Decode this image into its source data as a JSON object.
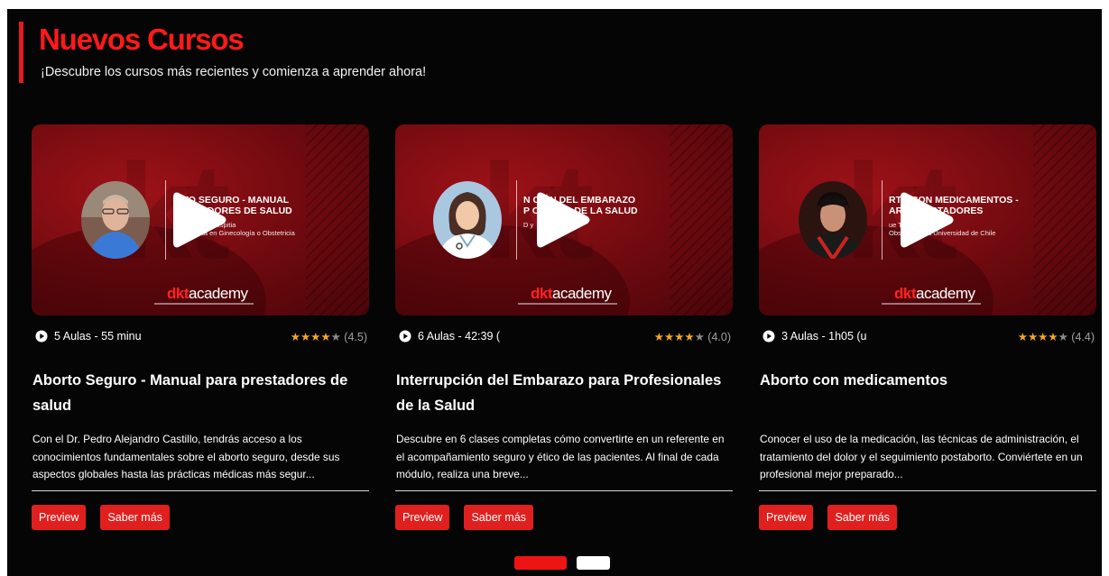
{
  "section": {
    "title": "Nuevos Cursos",
    "subtitle": "¡Descubre los cursos más recientes y comienza a aprender ahora!"
  },
  "colors": {
    "accent": "#e41b1b",
    "title": "#ff1a1a",
    "star": "#f5a623",
    "button": "#e0201f",
    "background": "#050505"
  },
  "icons": {
    "play_overlay": "play-icon",
    "lessons": "play-circle-icon",
    "rating": "star-icon"
  },
  "cards": [
    {
      "thumbnail": {
        "title_line1": "RTO SEGURO - MANUAL",
        "title_line2": "RESTADORES DE SALUD",
        "sub_line1": "ndro Castillo Espitia",
        "sub_line2": "specialista en Ginecología o Obstetricia",
        "logo_prefix": "dkt",
        "logo_suffix": "academy",
        "avatar": "man-photo"
      },
      "lessons": "5 Aulas - 55 minu",
      "stars": "★★★★",
      "star_off": "★",
      "rating_value": "(4.5)",
      "title": "Aborto Seguro - Manual para prestadores de salud",
      "description": "Con el Dr. Pedro Alejandro Castillo, tendrás acceso a los conocimientos fundamentales sobre el aborto seguro, desde sus aspectos globales hasta las prácticas médicas más segur...",
      "preview_label": "Preview",
      "more_label": "Saber más"
    },
    {
      "thumbnail": {
        "title_line1": "N    CIÓN DEL EMBARAZO",
        "title_line2": "P    ONALES DE LA SALUD",
        "sub_line1": "D          y",
        "sub_line2": "",
        "logo_prefix": "dkt",
        "logo_suffix": "academy",
        "avatar": "doctor-illustration"
      },
      "lessons": "6 Aulas - 42:39 (",
      "stars": "★★★★",
      "star_off": "★",
      "rating_value": "(4.0)",
      "title": "Interrupción del Embarazo para Profesionales de la Salud",
      "description": "Descubre en 6 clases completas cómo convertirte en un referente en el acompañamiento seguro y ético de las pacientes. Al final de cada módulo, realiza una breve...",
      "preview_label": "Preview",
      "more_label": "Saber más"
    },
    {
      "thumbnail": {
        "title_line1": "RTO CON MEDICAMENTOS -",
        "title_line2": "ARA PRESTADORES",
        "sub_line1": "ue Truan",
        "sub_line2": "Obstetra de la Universidad de Chile",
        "logo_prefix": "dkt",
        "logo_suffix": "academy",
        "avatar": "man-photo-2"
      },
      "lessons": "3 Aulas - 1h05 (u",
      "stars": "★★★★",
      "star_off": "★",
      "rating_value": "(4.4)",
      "title": "Aborto con medicamentos",
      "description": "Conocer el uso de la medicación, las técnicas de administración, el tratamiento del dolor y el seguimiento postaborto. Conviértete en un profesional mejor preparado...",
      "preview_label": "Preview",
      "more_label": "Saber más"
    }
  ],
  "pagination": {
    "pages": 2,
    "active": 1
  }
}
